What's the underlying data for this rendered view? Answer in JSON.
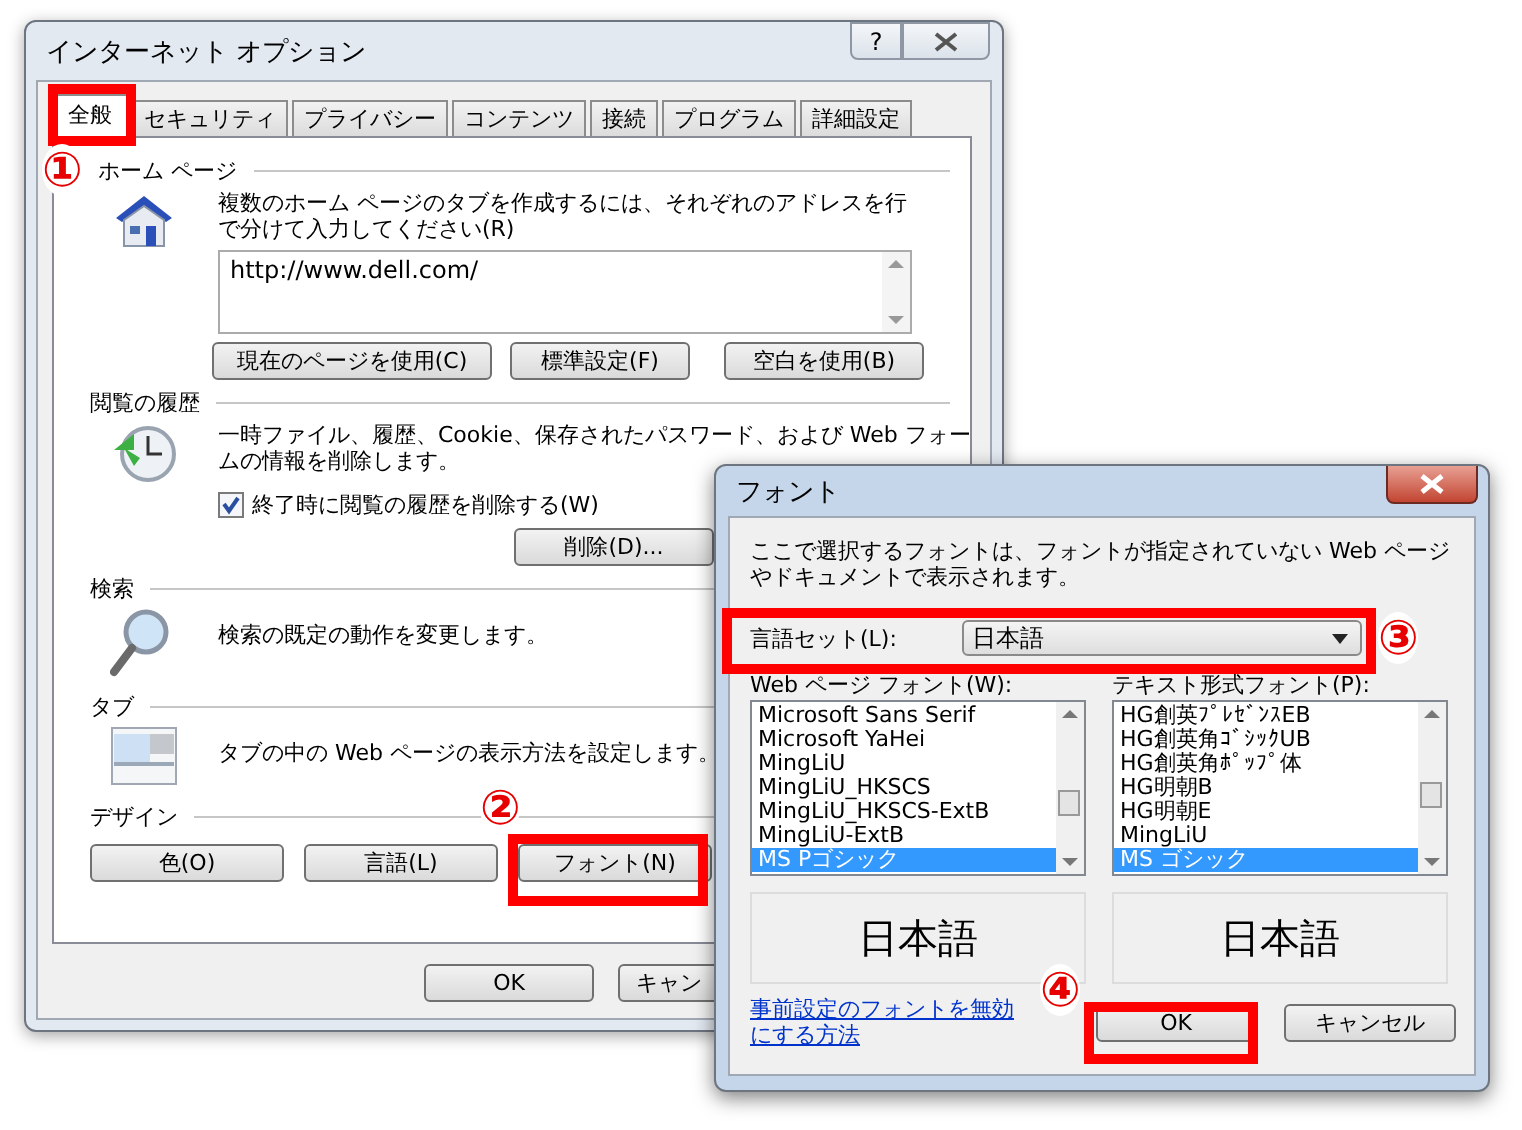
{
  "main_window": {
    "title": "インターネット オプション",
    "help_button": "?",
    "tabs": [
      {
        "label": "全般",
        "selected": true
      },
      {
        "label": "セキュリティ",
        "selected": false
      },
      {
        "label": "プライバシー",
        "selected": false
      },
      {
        "label": "コンテンツ",
        "selected": false
      },
      {
        "label": "接続",
        "selected": false
      },
      {
        "label": "プログラム",
        "selected": false
      },
      {
        "label": "詳細設定",
        "selected": false
      }
    ],
    "sections": [
      {
        "kind": "homepage",
        "heading": "ホーム ページ",
        "description": "複数のホーム ページのタブを作成するには、それぞれのアドレスを行で分けて入力してください(R)",
        "value": "http://www.dell.com/",
        "buttons": [
          "現在のページを使用(C)",
          "標準設定(F)",
          "空白を使用(B)"
        ]
      },
      {
        "kind": "history",
        "heading": "閲覧の履歴",
        "description": "一時ファイル、履歴、Cookie、保存されたパスワード、および Web フォームの情報を削除します。",
        "checkbox": {
          "label": "終了時に閲覧の履歴を削除する(W)",
          "checked": true
        },
        "buttons": [
          "削除(D)..."
        ]
      },
      {
        "kind": "search",
        "heading": "検索",
        "description": "検索の既定の動作を変更します。"
      },
      {
        "kind": "tabs",
        "heading": "タブ",
        "description": "タブの中の Web ページの表示方法を設定します。"
      },
      {
        "kind": "design",
        "heading": "デザイン",
        "buttons": [
          "色(O)",
          "言語(L)",
          "フォント(N)"
        ]
      }
    ],
    "footer_buttons": [
      "OK",
      "キャン"
    ]
  },
  "font_dialog": {
    "title": "フォント",
    "description": "ここで選択するフォントは、フォントが指定されていない Web ページやドキュメントで表示されます。",
    "language_label": "言語セット(L):",
    "language_value": "日本語",
    "lists": [
      {
        "label": "Web ページ フォント(W):",
        "items": [
          {
            "label": "Microsoft Sans Serif",
            "selected": false
          },
          {
            "label": "Microsoft YaHei",
            "selected": false
          },
          {
            "label": "MingLiU",
            "selected": false
          },
          {
            "label": "MingLiU_HKSCS",
            "selected": false
          },
          {
            "label": "MingLiU_HKSCS-ExtB",
            "selected": false
          },
          {
            "label": "MingLiU-ExtB",
            "selected": false
          },
          {
            "label": "MS Pゴシック",
            "selected": true
          }
        ],
        "preview": "日本語"
      },
      {
        "label": "テキスト形式フォント(P):",
        "items": [
          {
            "label": "HG創英ﾌﾟﾚｾﾞﾝｽEB",
            "selected": false
          },
          {
            "label": "HG創英角ｺﾞｼｯｸUB",
            "selected": false
          },
          {
            "label": "HG創英角ﾎﾟｯﾌﾟ体",
            "selected": false
          },
          {
            "label": "HG明朝B",
            "selected": false
          },
          {
            "label": "HG明朝E",
            "selected": false
          },
          {
            "label": "MingLiU",
            "selected": false
          },
          {
            "label": "MS ゴシック",
            "selected": true
          }
        ],
        "preview": "日本語"
      }
    ],
    "link": "事前設定のフォントを無効にする方法",
    "buttons": [
      "OK",
      "キャンセル"
    ]
  },
  "annotations": [
    {
      "label": "①"
    },
    {
      "label": "②"
    },
    {
      "label": "③"
    },
    {
      "label": "④"
    }
  ]
}
